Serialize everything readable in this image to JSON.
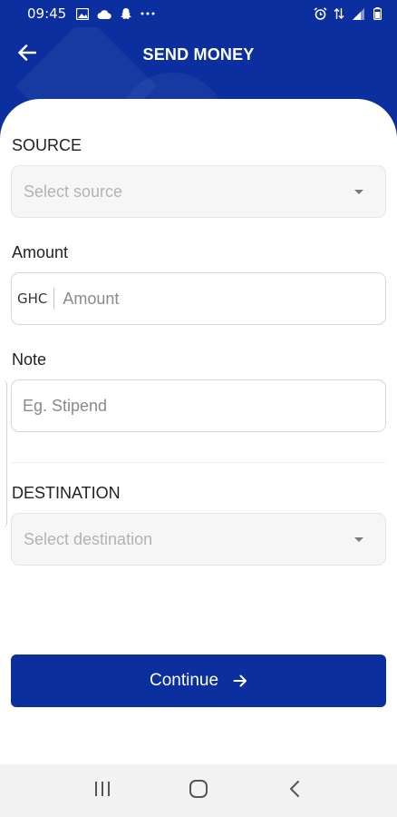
{
  "status_bar": {
    "time": "09:45",
    "left_icons": [
      "image-icon",
      "cloud-icon",
      "snapchat-icon",
      "more-dots-icon"
    ],
    "right_icons": [
      "alarm-icon",
      "data-arrows-icon",
      "signal-icon",
      "battery-icon"
    ]
  },
  "header": {
    "title": "SEND MONEY",
    "back_icon": "arrow-left-icon"
  },
  "form": {
    "source": {
      "label": "SOURCE",
      "placeholder": "Select source"
    },
    "amount": {
      "label": "Amount",
      "currency": "GHC",
      "placeholder": "Amount"
    },
    "note": {
      "label": "Note",
      "placeholder": "Eg. Stipend"
    },
    "destination": {
      "label": "DESTINATION",
      "placeholder": "Select destination"
    }
  },
  "continue_button": {
    "label": "Continue",
    "icon": "arrow-right-icon"
  },
  "nav_bar": {
    "buttons": [
      "recent-apps-icon",
      "home-icon",
      "back-icon"
    ]
  },
  "colors": {
    "primary": "#0b2f9e",
    "background": "#ffffff",
    "nav_background": "#f2f2f2"
  }
}
